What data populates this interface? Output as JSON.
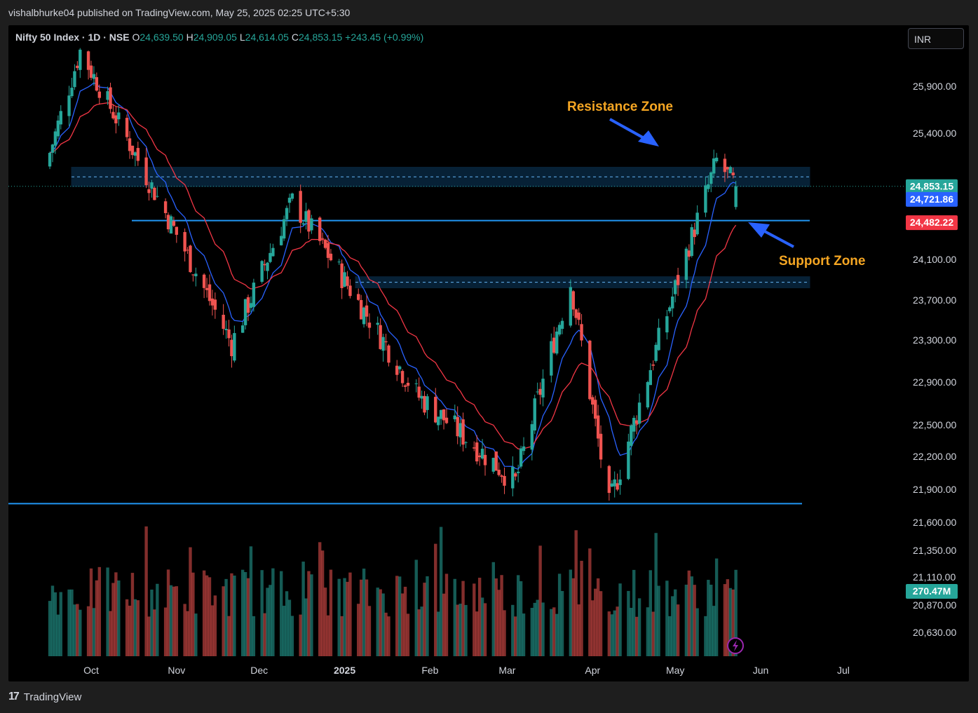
{
  "header": {
    "text": "vishalbhurke04 published on TradingView.com, May 25, 2025 02:25 UTC+5:30"
  },
  "legend": {
    "symbol": "Nifty 50 Index · 1D · NSE",
    "o_label": "O",
    "o_value": "24,639.50",
    "h_label": "H",
    "h_value": "24,909.05",
    "l_label": "L",
    "l_value": "24,614.05",
    "c_label": "C",
    "c_value": "24,853.15",
    "change": "+243.45 (+0.99%)"
  },
  "currency": "INR",
  "footer": {
    "brand": "TradingView"
  },
  "colors": {
    "up": "#26a69a",
    "down": "#ef5350",
    "ema_fast": "#2962ff",
    "ema_slow": "#f23645",
    "zone": "#2196f3",
    "annotation": "#f5a623"
  },
  "chart_data": {
    "type": "candlestick",
    "ylim": [
      20500,
      26300
    ],
    "y_ticks": [
      "25,900.00",
      "25,400.00",
      "24,100.00",
      "23,700.00",
      "23,300.00",
      "22,900.00",
      "22,500.00",
      "22,200.00",
      "21,900.00",
      "21,600.00",
      "21,350.00",
      "21,110.00",
      "20,870.00",
      "20,630.00"
    ],
    "y_tick_values": [
      25900,
      25400,
      24100,
      23700,
      23300,
      22900,
      22500,
      22200,
      21900,
      21600,
      21350,
      21110,
      20870,
      20630
    ],
    "x_ticks": [
      "Oct",
      "Nov",
      "Dec",
      "2025",
      "Feb",
      "Mar",
      "Apr",
      "May",
      "Jun",
      "Jul"
    ],
    "price_tags": [
      {
        "label": "24,853.15",
        "value": 24853.15,
        "color": "#26a69a"
      },
      {
        "label": "24,721.86",
        "value": 24721.86,
        "color": "#2962ff"
      },
      {
        "label": "24,482.22",
        "value": 24482.22,
        "color": "#f23645"
      },
      {
        "label": "270.47M",
        "value": 20990,
        "color": "#26a69a"
      }
    ],
    "zones": [
      {
        "name": "resistance",
        "low": 24850,
        "high": 25050,
        "mid": 24950
      },
      {
        "name": "support",
        "level": 24500
      },
      {
        "name": "lower band",
        "low": 23820,
        "high": 23930,
        "mid": 23875
      },
      {
        "name": "base",
        "level": 21770
      }
    ],
    "annotations": [
      {
        "text": "Resistance Zone"
      },
      {
        "text": "Support Zone"
      }
    ],
    "key_points": [
      {
        "date": "2024-09-27",
        "value": 26277
      },
      {
        "date": "2024-11-21",
        "value": 23263
      },
      {
        "date": "2024-12-13",
        "value": 24700
      },
      {
        "date": "2025-01-27",
        "value": 22786
      },
      {
        "date": "2025-03-04",
        "value": 21964
      },
      {
        "date": "2025-03-24",
        "value": 23869
      },
      {
        "date": "2025-04-07",
        "value": 21743
      },
      {
        "date": "2025-05-16",
        "value": 25116
      },
      {
        "date": "2025-05-23",
        "value": 24853.15
      }
    ]
  }
}
